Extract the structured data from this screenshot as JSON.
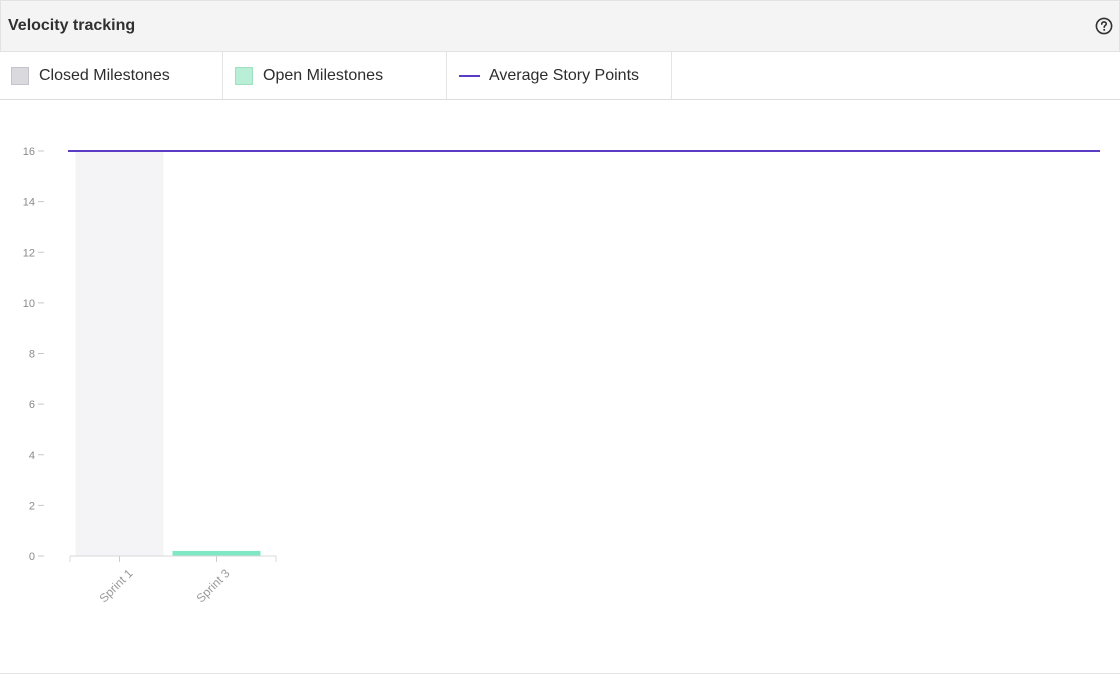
{
  "header": {
    "title": "Velocity tracking",
    "help_icon": "question-circle-icon"
  },
  "legend": [
    {
      "label": "Closed Milestones",
      "kind": "box",
      "color": "#d9d9de",
      "border": "#c4c4cc"
    },
    {
      "label": "Open Milestones",
      "kind": "box",
      "color": "#b9efd6",
      "border": "#9fe0c2"
    },
    {
      "label": "Average Story Points",
      "kind": "line",
      "color": "#5b3cc4"
    }
  ],
  "chart_data": {
    "type": "bar",
    "categories": [
      "Sprint 1",
      "Sprint 3"
    ],
    "series": [
      {
        "name": "Closed Milestones",
        "values": [
          16,
          0
        ],
        "color": "#f4f4f6"
      },
      {
        "name": "Open Milestones",
        "values": [
          0,
          0.2
        ],
        "color": "#7ee8c4"
      }
    ],
    "line": {
      "name": "Average Story Points",
      "value": 16,
      "color": "#5b3cc4"
    },
    "yticks": [
      0,
      2,
      4,
      6,
      8,
      10,
      12,
      14,
      16
    ],
    "ylim": [
      0,
      16
    ],
    "xlabel": "",
    "ylabel": "",
    "title": ""
  }
}
